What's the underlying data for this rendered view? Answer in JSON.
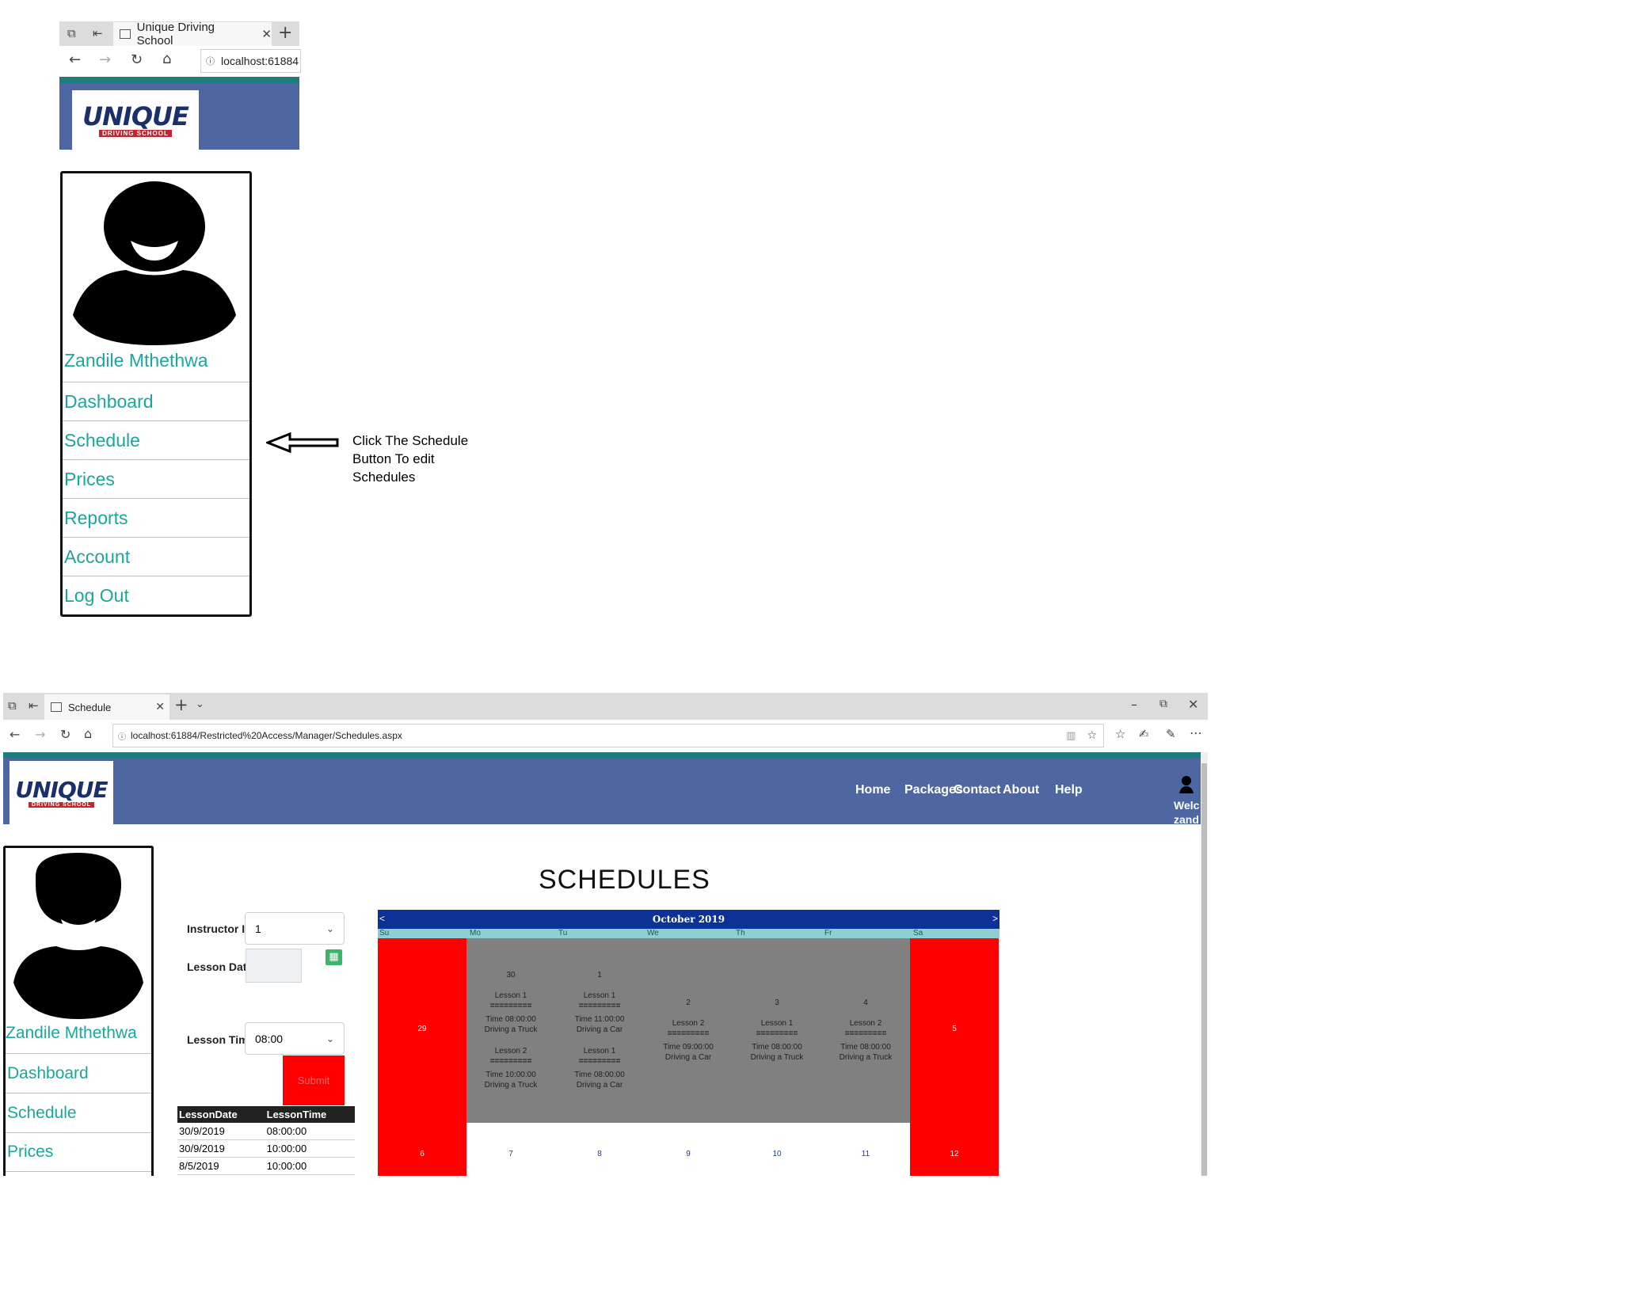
{
  "top_window": {
    "tab_title": "Unique Driving School",
    "url": "localhost:61884",
    "logo": {
      "main": "UNIQUE",
      "sub": "DRIVING SCHOOL"
    }
  },
  "top_sidebar": {
    "user_name": "Zandile Mthethwa",
    "items": [
      "Dashboard",
      "Schedule",
      "Prices",
      "Reports",
      "Account",
      "Log Out"
    ]
  },
  "annotation": {
    "lines": [
      "Click The Schedule",
      "Button To edit",
      "Schedules"
    ]
  },
  "bottom_window": {
    "tab_title": "Schedule",
    "url": "localhost:61884/Restricted%20Access/Manager/Schedules.aspx",
    "logo": {
      "main": "UNIQUE",
      "sub": "DRIVING SCHOOL"
    },
    "nav": [
      "Home",
      "Packages",
      "Contact",
      "About",
      "Help"
    ],
    "welcome": [
      "Welc",
      "zand"
    ]
  },
  "bottom_sidebar": {
    "user_name": "Zandile Mthethwa",
    "items": [
      "Dashboard",
      "Schedule",
      "Prices"
    ]
  },
  "schedule_page": {
    "title": "SCHEDULES",
    "instructor_label": "Instructor ID",
    "instructor_value": "1",
    "lesson_date_label": "Lesson Date",
    "lesson_time_label": "Lesson Time",
    "lesson_time_value": "08:00",
    "submit_label": "Submit",
    "table": {
      "headers": [
        "LessonDate",
        "LessonTime"
      ],
      "rows": [
        [
          "30/9/2019",
          "08:00:00"
        ],
        [
          "30/9/2019",
          "10:00:00"
        ],
        [
          "8/5/2019",
          "10:00:00"
        ]
      ]
    }
  },
  "calendar": {
    "title": "October 2019",
    "prev": "<",
    "next": ">",
    "days": [
      "Su",
      "Mo",
      "Tu",
      "We",
      "Th",
      "Fr",
      "Sa"
    ],
    "week1": [
      {
        "day": "29",
        "lessons": []
      },
      {
        "day": "30",
        "lessons": [
          {
            "name": "Lesson 1",
            "sep": "=========",
            "time": "Time 08:00:00",
            "type": "Driving a Truck"
          },
          {
            "name": "Lesson 2",
            "sep": "=========",
            "time": "Time 10:00:00",
            "type": "Driving a Truck"
          }
        ]
      },
      {
        "day": "1",
        "lessons": [
          {
            "name": "Lesson 1",
            "sep": "=========",
            "time": "Time 11:00:00",
            "type": "Driving a Car"
          },
          {
            "name": "Lesson 1",
            "sep": "=========",
            "time": "Time 08:00:00",
            "type": "Driving a Car"
          }
        ]
      },
      {
        "day": "2",
        "lessons": [
          {
            "name": "Lesson 2",
            "sep": "=========",
            "time": "Time 09:00:00",
            "type": "Driving a Car"
          }
        ]
      },
      {
        "day": "3",
        "lessons": [
          {
            "name": "Lesson 1",
            "sep": "=========",
            "time": "Time 08:00:00",
            "type": "Driving a Truck"
          }
        ]
      },
      {
        "day": "4",
        "lessons": [
          {
            "name": "Lesson 2",
            "sep": "=========",
            "time": "Time 08:00:00",
            "type": "Driving a Truck"
          }
        ]
      },
      {
        "day": "5",
        "lessons": []
      }
    ],
    "week2": [
      "6",
      "7",
      "8",
      "9",
      "10",
      "11",
      "12"
    ],
    "colors": {
      "weekend": "#ff0000",
      "week_busy": "#808080",
      "header": "#0c3296",
      "day_row": "#8ecfcf"
    }
  }
}
